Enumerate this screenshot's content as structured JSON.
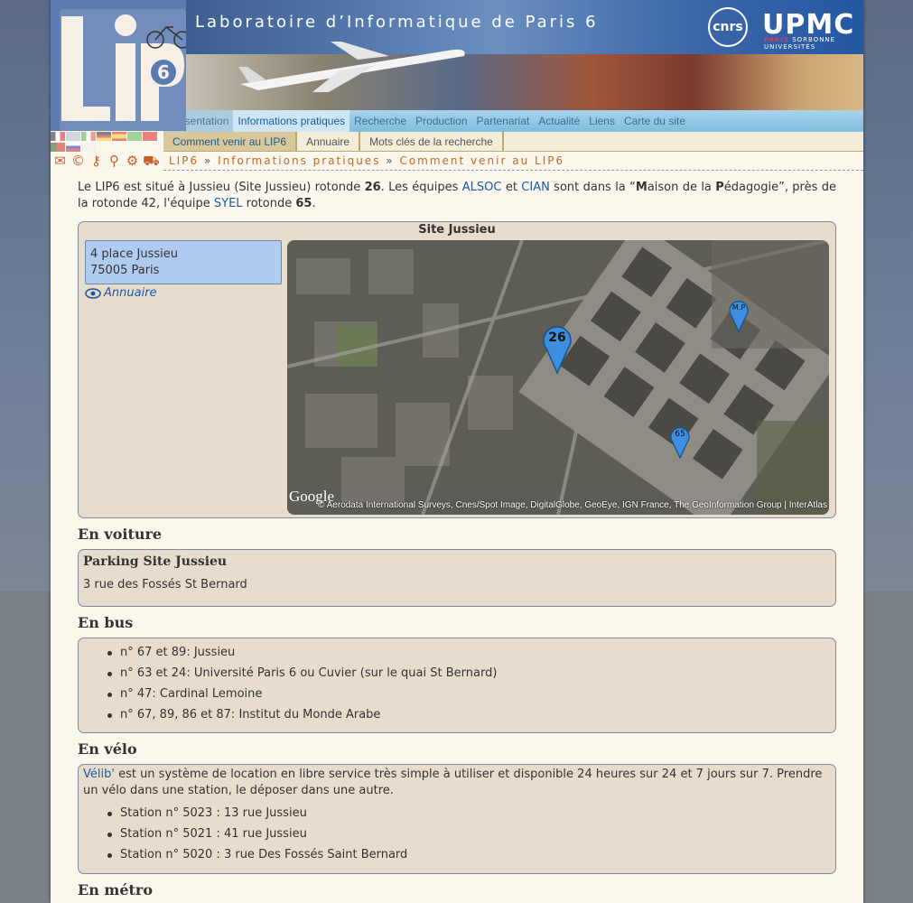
{
  "banner": {
    "title": "Laboratoire d’Informatique de Paris 6",
    "cnrs": "cnrs",
    "upmc": "UPMC",
    "upmc_sub": "SORBONNE UNIVERSITÉS",
    "upmc_sub_prefix": "PARIS",
    "logo_text": "LIP6"
  },
  "nav": {
    "main": [
      "Présentation",
      "Informations pratiques",
      "Recherche",
      "Production",
      "Partenariat",
      "Actualité",
      "Liens",
      "Carte du site"
    ],
    "sub": [
      "Comment venir au LIP6",
      "Annuaire",
      "Mots clés de la recherche"
    ]
  },
  "breadcrumb": {
    "item1": "LIP6",
    "item2": "Informations pratiques",
    "item3": "Comment venir au LIP6",
    "sep": "»"
  },
  "icons": [
    "mail-icon",
    "copyright-icon",
    "key-icon",
    "search-key-icon",
    "settings-icon",
    "car-icon"
  ],
  "intro": {
    "p1": "Le LIP6 est situé à Jussieu (Site Jussieu) rotonde ",
    "b1": "26",
    "p2": ". Les équipes ",
    "a1": "ALSOC",
    "p3": " et ",
    "a2": "CIAN",
    "p4": " sont dans la “",
    "m": "M",
    "p5": "aison de la ",
    "pp": "P",
    "p6": "édagogie”, près de la rotonde 42, l'équipe ",
    "a3": "SYEL",
    "p7": " rotonde ",
    "b2": "65",
    "p8": "."
  },
  "site": {
    "title": "Site Jussieu",
    "address_line1": "4 place Jussieu",
    "address_line2": "75005 Paris",
    "annuaire": "Annuaire",
    "map": {
      "pin_main": "26",
      "pin_mp": "M.P",
      "pin_65": "65",
      "google": "Google",
      "credits": "© Aerodata International Surveys, Cnes/Spot Image, DigitalGlobe, GeoEye, IGN France, The GeoInformation Group | InterAtlas"
    }
  },
  "voiture": {
    "heading": "En voiture",
    "title": "Parking Site Jussieu",
    "text": "3 rue des Fossés St Bernard"
  },
  "bus": {
    "heading": "En bus",
    "items": [
      "n° 67 et 89: Jussieu",
      "n° 63 et 24: Université Paris 6 ou Cuvier (sur le quai St Bernard)",
      "n° 47: Cardinal Lemoine",
      "n° 67, 89, 86 et 87: Institut du Monde Arabe"
    ]
  },
  "velo": {
    "heading": "En vélo",
    "link": "Vélib'",
    "text": " est un système de location en libre service très simple à utiliser et disponible 24 heures sur 24 et 7 jours sur 7. Prendre un vélo dans une station, le déposer dans une autre.",
    "items": [
      "Station n° 5023 : 13 rue Jussieu",
      "Station n° 5021 : 41 rue Jussieu",
      "Station n° 5020 : 3 rue Des Fossés Saint Bernard"
    ]
  },
  "metro": {
    "heading": "En métro"
  }
}
